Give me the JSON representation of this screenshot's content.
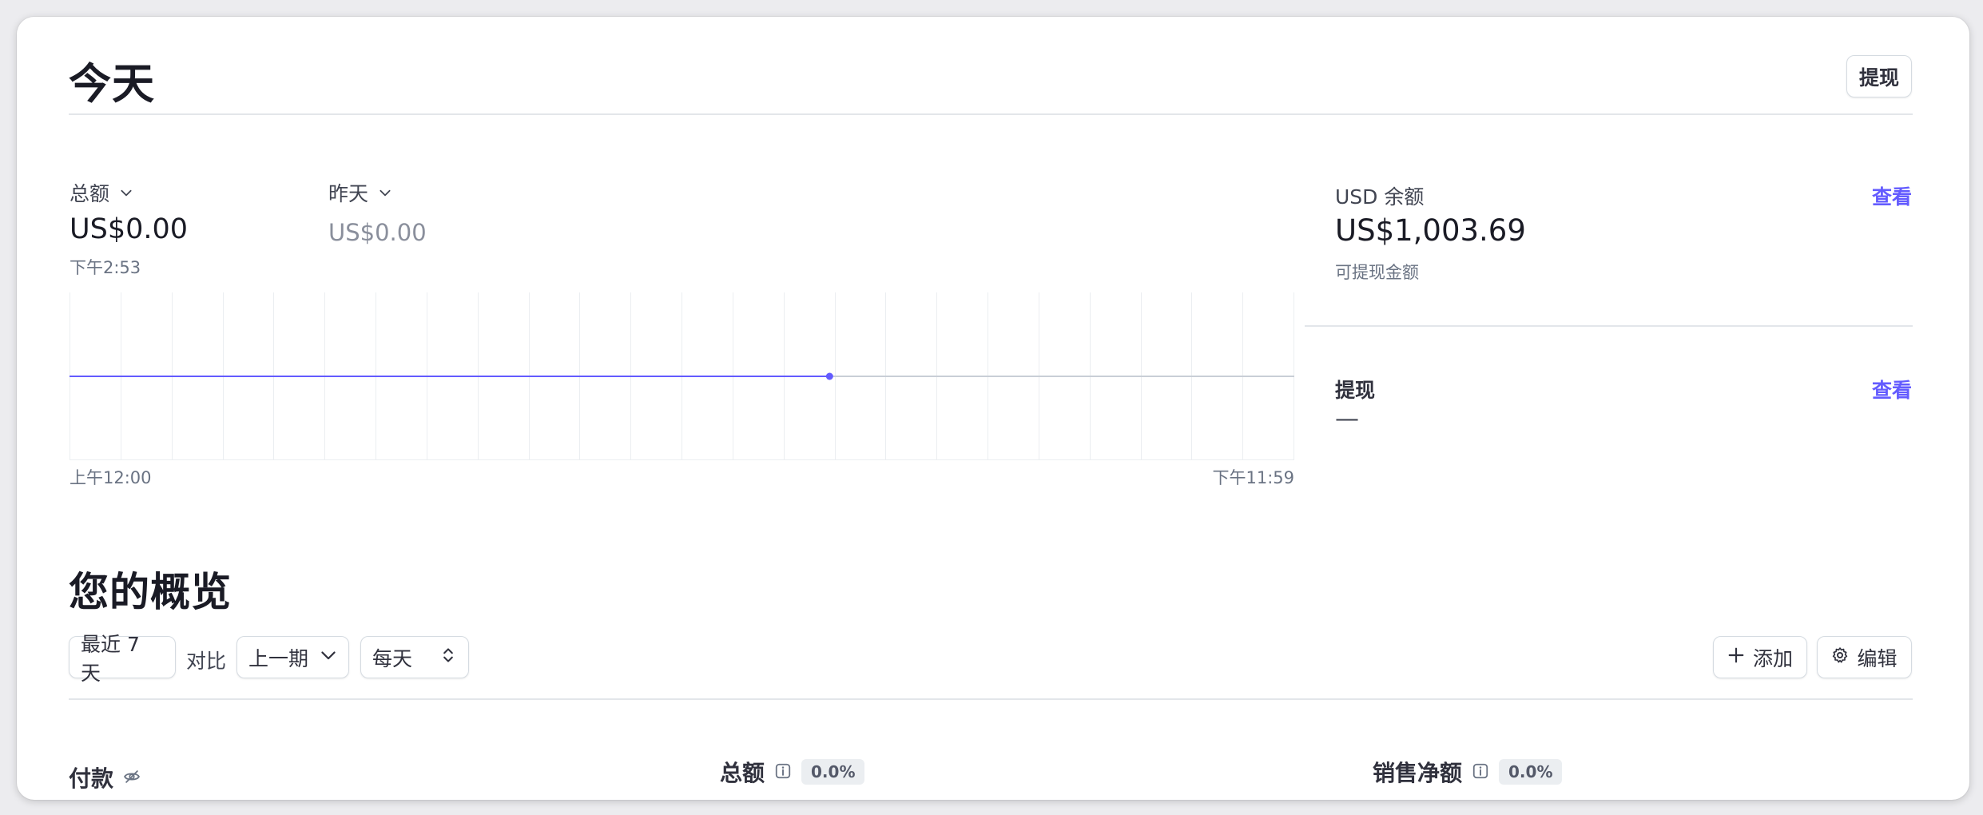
{
  "header": {
    "title": "今天",
    "withdraw_button": "提现"
  },
  "today_chart": {
    "primary_metric": "总额",
    "compare_metric": "昨天",
    "primary_amount": "US$0.00",
    "compare_amount": "US$0.00",
    "current_time": "下午2:53",
    "axis_start": "上午12:00",
    "axis_end": "下午11:59",
    "accent_color": "#635bff"
  },
  "chart_data": {
    "type": "line",
    "x": [
      "上午12:00",
      "下午2:53"
    ],
    "series": [
      {
        "values": [
          0,
          0
        ]
      }
    ],
    "xlabel": "",
    "ylabel": "",
    "grid": true
  },
  "balance": {
    "title": "USD 余额",
    "view_link": "查看",
    "amount": "US$1,003.69",
    "subtitle": "可提现金额"
  },
  "payouts": {
    "title": "提现",
    "view_link": "查看",
    "value": "—"
  },
  "overview": {
    "title": "您的概览",
    "range_button": "最近 7 天",
    "compare_label": "对比",
    "period_select": "上一期",
    "interval_select": "每天",
    "add_button": "添加",
    "edit_button": "编辑"
  },
  "metrics": {
    "payments_label": "付款",
    "gross_label": "总额",
    "gross_change": "0.0%",
    "net_label": "销售净额",
    "net_change": "0.0%"
  }
}
